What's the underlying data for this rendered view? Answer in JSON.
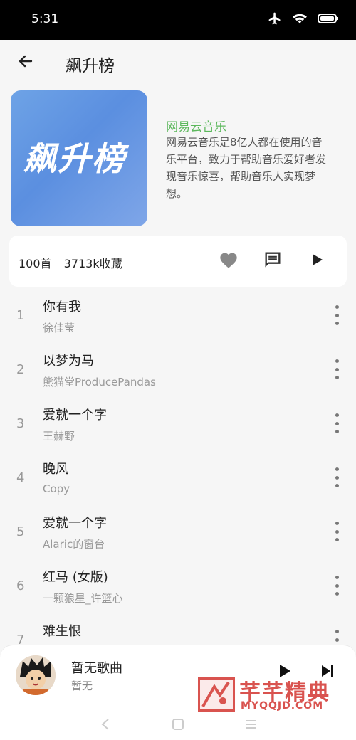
{
  "status_bar": {
    "time": "5:31"
  },
  "header": {
    "title": "飙升榜"
  },
  "cover": {
    "text": "飙升榜"
  },
  "info": {
    "title": "网易云音乐",
    "description": "网易云音乐是8亿人都在使用的音乐平台，致力于帮助音乐爱好者发现音乐惊喜，帮助音乐人实现梦想。"
  },
  "stats": {
    "count": "100首",
    "favorites": "3713k收藏"
  },
  "songs": [
    {
      "index": "1",
      "title": "你有我",
      "artist": "徐佳莹"
    },
    {
      "index": "2",
      "title": "以梦为马",
      "artist": "熊猫堂ProducePandas"
    },
    {
      "index": "3",
      "title": "爱就一个字",
      "artist": "王赫野"
    },
    {
      "index": "4",
      "title": "晚风",
      "artist": "Copy"
    },
    {
      "index": "5",
      "title": "爱就一个字",
      "artist": "Alaric的窗台"
    },
    {
      "index": "6",
      "title": "红马 (女版)",
      "artist": "一颗狼星_许篮心"
    },
    {
      "index": "7",
      "title": "难生恨",
      "artist": ""
    }
  ],
  "player": {
    "title": "暂无歌曲",
    "artist": "暂无"
  },
  "watermark": {
    "text": "芊芊精典",
    "sub": "MYQQJD.COM"
  },
  "colors": {
    "accent": "#5cb85c",
    "cover_blue": "#6a9ce4",
    "watermark_red": "#d9534f"
  },
  "icons": [
    "back-arrow-icon",
    "heart-icon",
    "comment-icon",
    "play-icon",
    "more-vert-icon",
    "next-icon",
    "airplane-icon",
    "wifi-icon",
    "battery-icon"
  ]
}
